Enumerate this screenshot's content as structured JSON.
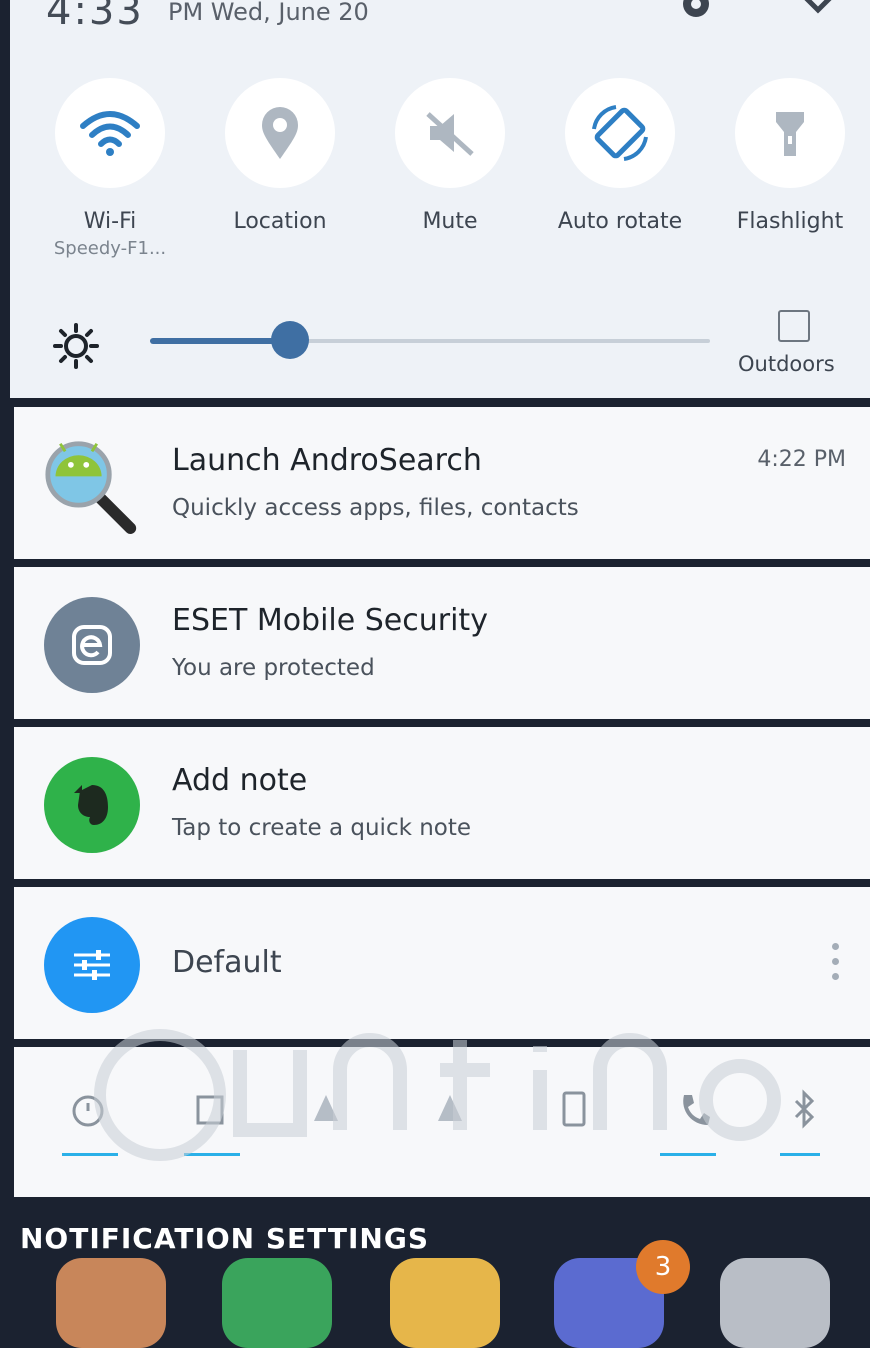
{
  "status": {
    "time": "4:33",
    "date": "PM Wed, June 20"
  },
  "quick_settings": {
    "tiles": [
      {
        "label": "Wi-Fi",
        "sub": "Speedy-F1...",
        "icon": "wifi-icon",
        "active": true
      },
      {
        "label": "Location",
        "sub": "",
        "icon": "location-icon",
        "active": false
      },
      {
        "label": "Mute",
        "sub": "",
        "icon": "mute-icon",
        "active": false
      },
      {
        "label": "Auto rotate",
        "sub": "",
        "icon": "auto-rotate-icon",
        "active": true
      },
      {
        "label": "Flashlight",
        "sub": "",
        "icon": "flashlight-icon",
        "active": false
      }
    ],
    "brightness_level": 0.25,
    "outdoors_label": "Outdoors",
    "outdoors_checked": false
  },
  "notifications": [
    {
      "title": "Launch AndroSearch",
      "text": "Quickly access apps, files, contacts",
      "time": "4:22 PM",
      "icon": "android-search-icon"
    },
    {
      "title": "ESET Mobile Security",
      "text": "You are protected",
      "time": "",
      "icon": "eset-icon"
    },
    {
      "title": "Add note",
      "text": "Tap to create a quick note",
      "time": "",
      "icon": "evernote-icon"
    },
    {
      "title": "",
      "text": "Default",
      "time": "",
      "icon": "sliders-icon"
    }
  ],
  "toggles_row": [
    "alarm-icon",
    "wifi-signal-icon",
    "sound-icon",
    "vibrate-icon",
    "screen-icon",
    "call-icon",
    "bluetooth-icon"
  ],
  "footer": {
    "notification_settings": "NOTIFICATION SETTINGS",
    "badge_count": "3"
  },
  "colors": {
    "accent": "#3f6fa3",
    "active_underline": "#2ab0e8",
    "eset": "#6f8296",
    "evernote": "#2fb24a",
    "default": "#2196f3"
  }
}
